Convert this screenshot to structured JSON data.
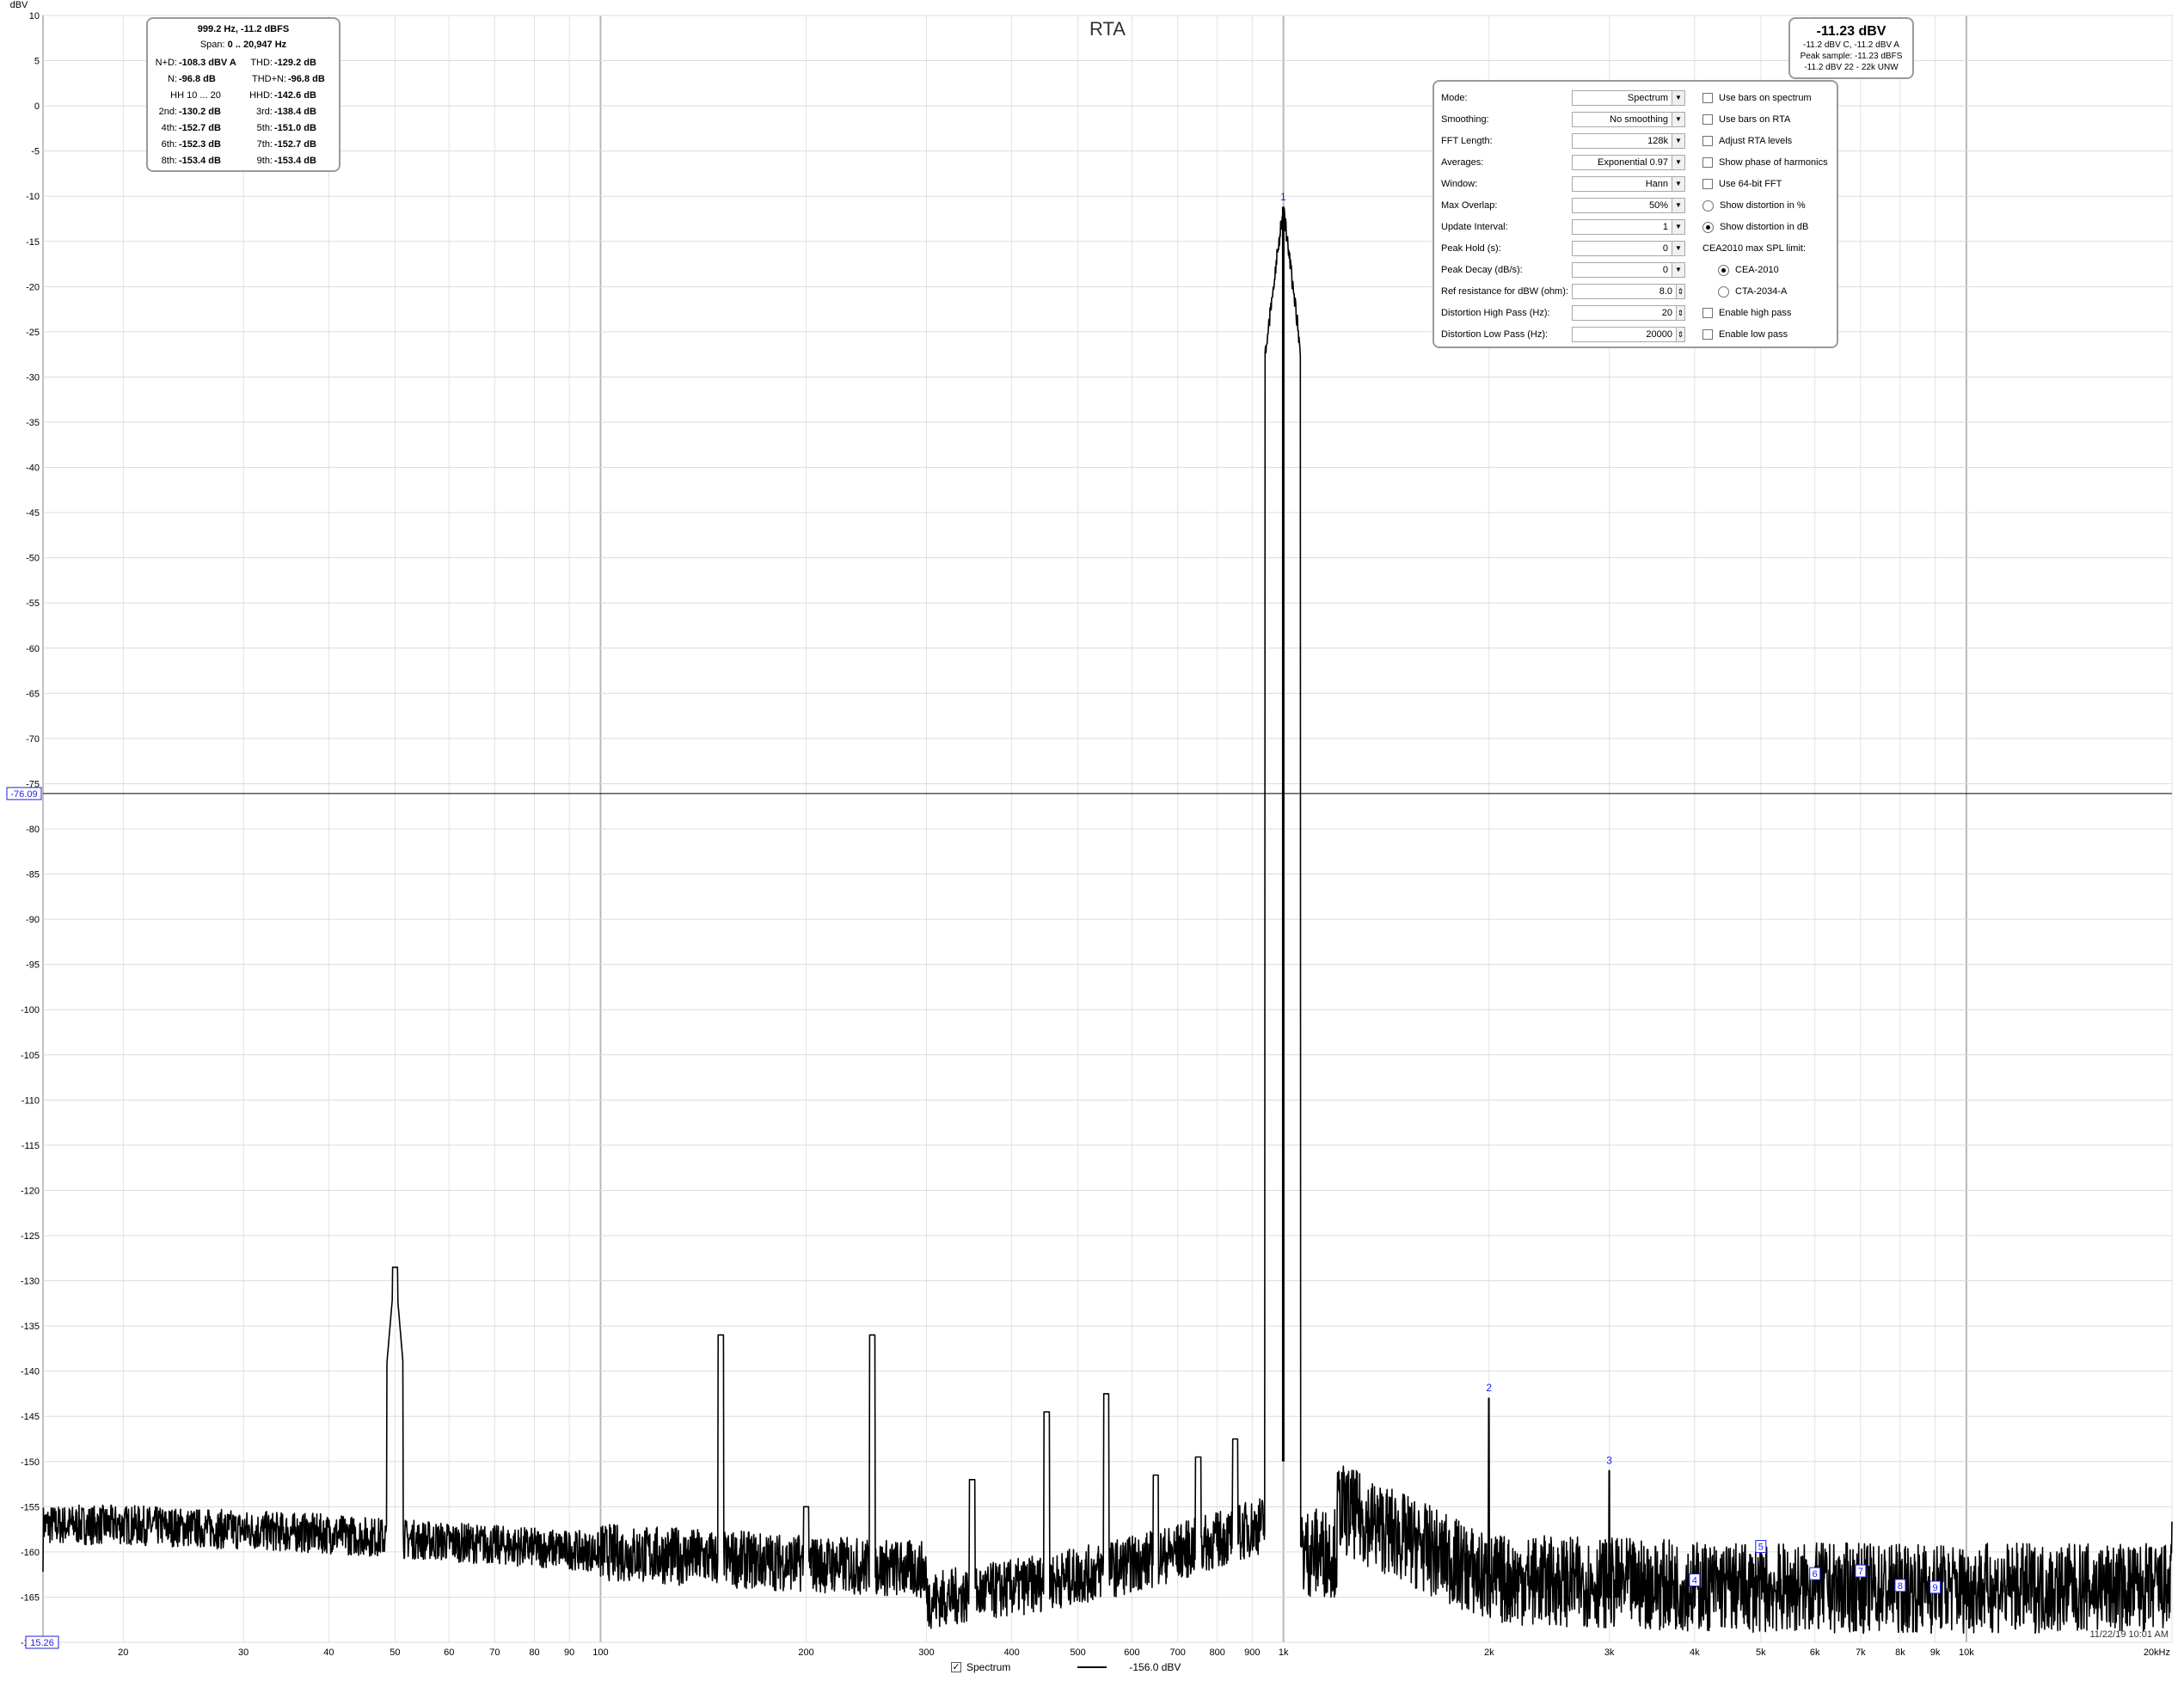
{
  "chart_data": {
    "type": "line",
    "title": "RTA",
    "ylabel": "dBV",
    "xscale": "log",
    "xlim": [
      15.26,
      20000
    ],
    "ylim": [
      -170,
      10
    ],
    "x_ticks": [
      "20",
      "30",
      "40",
      "50",
      "60",
      "70",
      "80",
      "90",
      "100",
      "200",
      "300",
      "400",
      "500",
      "600",
      "700",
      "800",
      "900",
      "1k",
      "2k",
      "3k",
      "4k",
      "5k",
      "6k",
      "7k",
      "8k",
      "9k",
      "10k",
      "20kHz"
    ],
    "x_tick_values": [
      20,
      30,
      40,
      50,
      60,
      70,
      80,
      90,
      100,
      200,
      300,
      400,
      500,
      600,
      700,
      800,
      900,
      1000,
      2000,
      3000,
      4000,
      5000,
      6000,
      7000,
      8000,
      9000,
      10000,
      20000
    ],
    "y_ticks": [
      10,
      5,
      0,
      -5,
      -10,
      -15,
      -20,
      -25,
      -30,
      -35,
      -40,
      -45,
      -50,
      -55,
      -60,
      -65,
      -70,
      -75,
      -80,
      -85,
      -90,
      -95,
      -100,
      -105,
      -110,
      -115,
      -120,
      -125,
      -130,
      -135,
      -140,
      -145,
      -150,
      -155,
      -160,
      -165,
      -170
    ],
    "grid": true,
    "cursor": {
      "x_label": "15.26",
      "y_label": "-76.09",
      "y": -76.09
    },
    "series": [
      {
        "name": "Spectrum",
        "color": "#000000",
        "legend_value": "-156.0 dBV",
        "noise_floor": [
          [
            15.26,
            -157
          ],
          [
            20,
            -157
          ],
          [
            40,
            -158
          ],
          [
            100,
            -160
          ],
          [
            300,
            -162
          ],
          [
            600,
            -162
          ],
          [
            900,
            -157
          ],
          [
            1000,
            -11.2
          ],
          [
            1200,
            -155
          ],
          [
            2000,
            -163
          ],
          [
            5000,
            -164
          ],
          [
            10000,
            -164
          ],
          [
            20000,
            -164
          ]
        ],
        "peaks": [
          {
            "x": 50,
            "y": -128.5
          },
          {
            "x": 150,
            "y": -136
          },
          {
            "x": 250,
            "y": -136
          },
          {
            "x": 350,
            "y": -152
          },
          {
            "x": 450,
            "y": -144.5
          },
          {
            "x": 550,
            "y": -142.5
          },
          {
            "x": 650,
            "y": -151.5
          },
          {
            "x": 750,
            "y": -149.5
          },
          {
            "x": 850,
            "y": -147.5
          },
          {
            "x": 999.2,
            "y": -11.2
          },
          {
            "x": 2000,
            "y": -143
          },
          {
            "x": 3000,
            "y": -151
          },
          {
            "x": 200,
            "y": -155
          }
        ]
      }
    ],
    "harmonic_markers": [
      {
        "label": "1",
        "x": 999.2,
        "y": -11.2
      },
      {
        "label": "2",
        "x": 2000,
        "y": -143
      },
      {
        "label": "3",
        "x": 3000,
        "y": -151
      },
      {
        "label": "4",
        "x": 4000,
        "y": -163.2
      },
      {
        "label": "5",
        "x": 5000,
        "y": -159.5
      },
      {
        "label": "6",
        "x": 6000,
        "y": -162.5
      },
      {
        "label": "7",
        "x": 7000,
        "y": -162.2
      },
      {
        "label": "8",
        "x": 8000,
        "y": -163.8
      },
      {
        "label": "9",
        "x": 9000,
        "y": -164
      }
    ],
    "timestamp": "11/22/19 10:01 AM"
  },
  "stats": {
    "header": "999.2 Hz, -11.2 dBFS",
    "span_label": "Span:",
    "span_value": "0 .. 20,947 Hz",
    "rows": [
      [
        {
          "label": "N+D:",
          "value": "-108.3 dBV A"
        },
        {
          "label": "THD:",
          "value": "-129.2 dB"
        }
      ],
      [
        {
          "label": "N:",
          "value": "-96.8 dB"
        },
        {
          "label": "THD+N:",
          "value": "-96.8 dB"
        }
      ],
      [
        {
          "label": "HH 10 ... 20",
          "value": ""
        },
        {
          "label": "HHD:",
          "value": "-142.6 dB"
        }
      ],
      [
        {
          "label": "2nd:",
          "value": "-130.2 dB"
        },
        {
          "label": "3rd:",
          "value": "-138.4 dB"
        }
      ],
      [
        {
          "label": "4th:",
          "value": "-152.7 dB"
        },
        {
          "label": "5th:",
          "value": "-151.0 dB"
        }
      ],
      [
        {
          "label": "6th:",
          "value": "-152.3 dB"
        },
        {
          "label": "7th:",
          "value": "-152.7 dB"
        }
      ],
      [
        {
          "label": "8th:",
          "value": "-153.4 dB"
        },
        {
          "label": "9th:",
          "value": "-153.4 dB"
        }
      ]
    ]
  },
  "level": {
    "main": "-11.23 dBV",
    "line1": "-11.2 dBV C, -11.2 dBV A",
    "line2": "Peak sample: -11.23 dBFS",
    "line3": "-11.2 dBV 22 - 22k UNW"
  },
  "settings": {
    "rows": [
      {
        "label": "Mode:",
        "value": "Spectrum",
        "kind": "dropdown"
      },
      {
        "label": "Smoothing:",
        "value": "No  smoothing",
        "kind": "dropdown"
      },
      {
        "label": "FFT Length:",
        "value": "128k",
        "kind": "dropdown"
      },
      {
        "label": "Averages:",
        "value": "Exponential 0.97",
        "kind": "dropdown"
      },
      {
        "label": "Window:",
        "value": "Hann",
        "kind": "dropdown"
      },
      {
        "label": "Max Overlap:",
        "value": "50%",
        "kind": "dropdown"
      },
      {
        "label": "Update Interval:",
        "value": "1",
        "kind": "dropdown"
      },
      {
        "label": "Peak Hold (s):",
        "value": "0",
        "kind": "dropdown"
      },
      {
        "label": "Peak Decay (dB/s):",
        "value": "0",
        "kind": "dropdown"
      },
      {
        "label": "Ref resistance for dBW (ohm):",
        "value": "8.0",
        "kind": "spinner"
      },
      {
        "label": "Distortion High Pass (Hz):",
        "value": "20",
        "kind": "spinner"
      },
      {
        "label": "Distortion Low Pass (Hz):",
        "value": "20000",
        "kind": "spinner"
      }
    ],
    "options": [
      {
        "label": "Use bars on spectrum",
        "kind": "checkbox",
        "checked": false
      },
      {
        "label": "Use bars on RTA",
        "kind": "checkbox",
        "checked": false
      },
      {
        "label": "Adjust RTA levels",
        "kind": "checkbox",
        "checked": false
      },
      {
        "label": "Show phase of harmonics",
        "kind": "checkbox",
        "checked": false
      },
      {
        "label": "Use 64-bit FFT",
        "kind": "checkbox",
        "checked": false
      },
      {
        "label": "Show distortion in %",
        "kind": "radio",
        "checked": false
      },
      {
        "label": "Show distortion in dB",
        "kind": "radio",
        "checked": true
      },
      {
        "label": "CEA2010 max SPL limit:",
        "kind": "label",
        "checked": false
      },
      {
        "label": "CEA-2010",
        "kind": "radio-indent",
        "checked": true
      },
      {
        "label": "CTA-2034-A",
        "kind": "radio-indent",
        "checked": false
      },
      {
        "label": "Enable high pass",
        "kind": "checkbox",
        "checked": false
      },
      {
        "label": "Enable low pass",
        "kind": "checkbox",
        "checked": false
      }
    ]
  },
  "legend": {
    "label": "Spectrum",
    "checked": true,
    "value": "-156.0 dBV"
  }
}
